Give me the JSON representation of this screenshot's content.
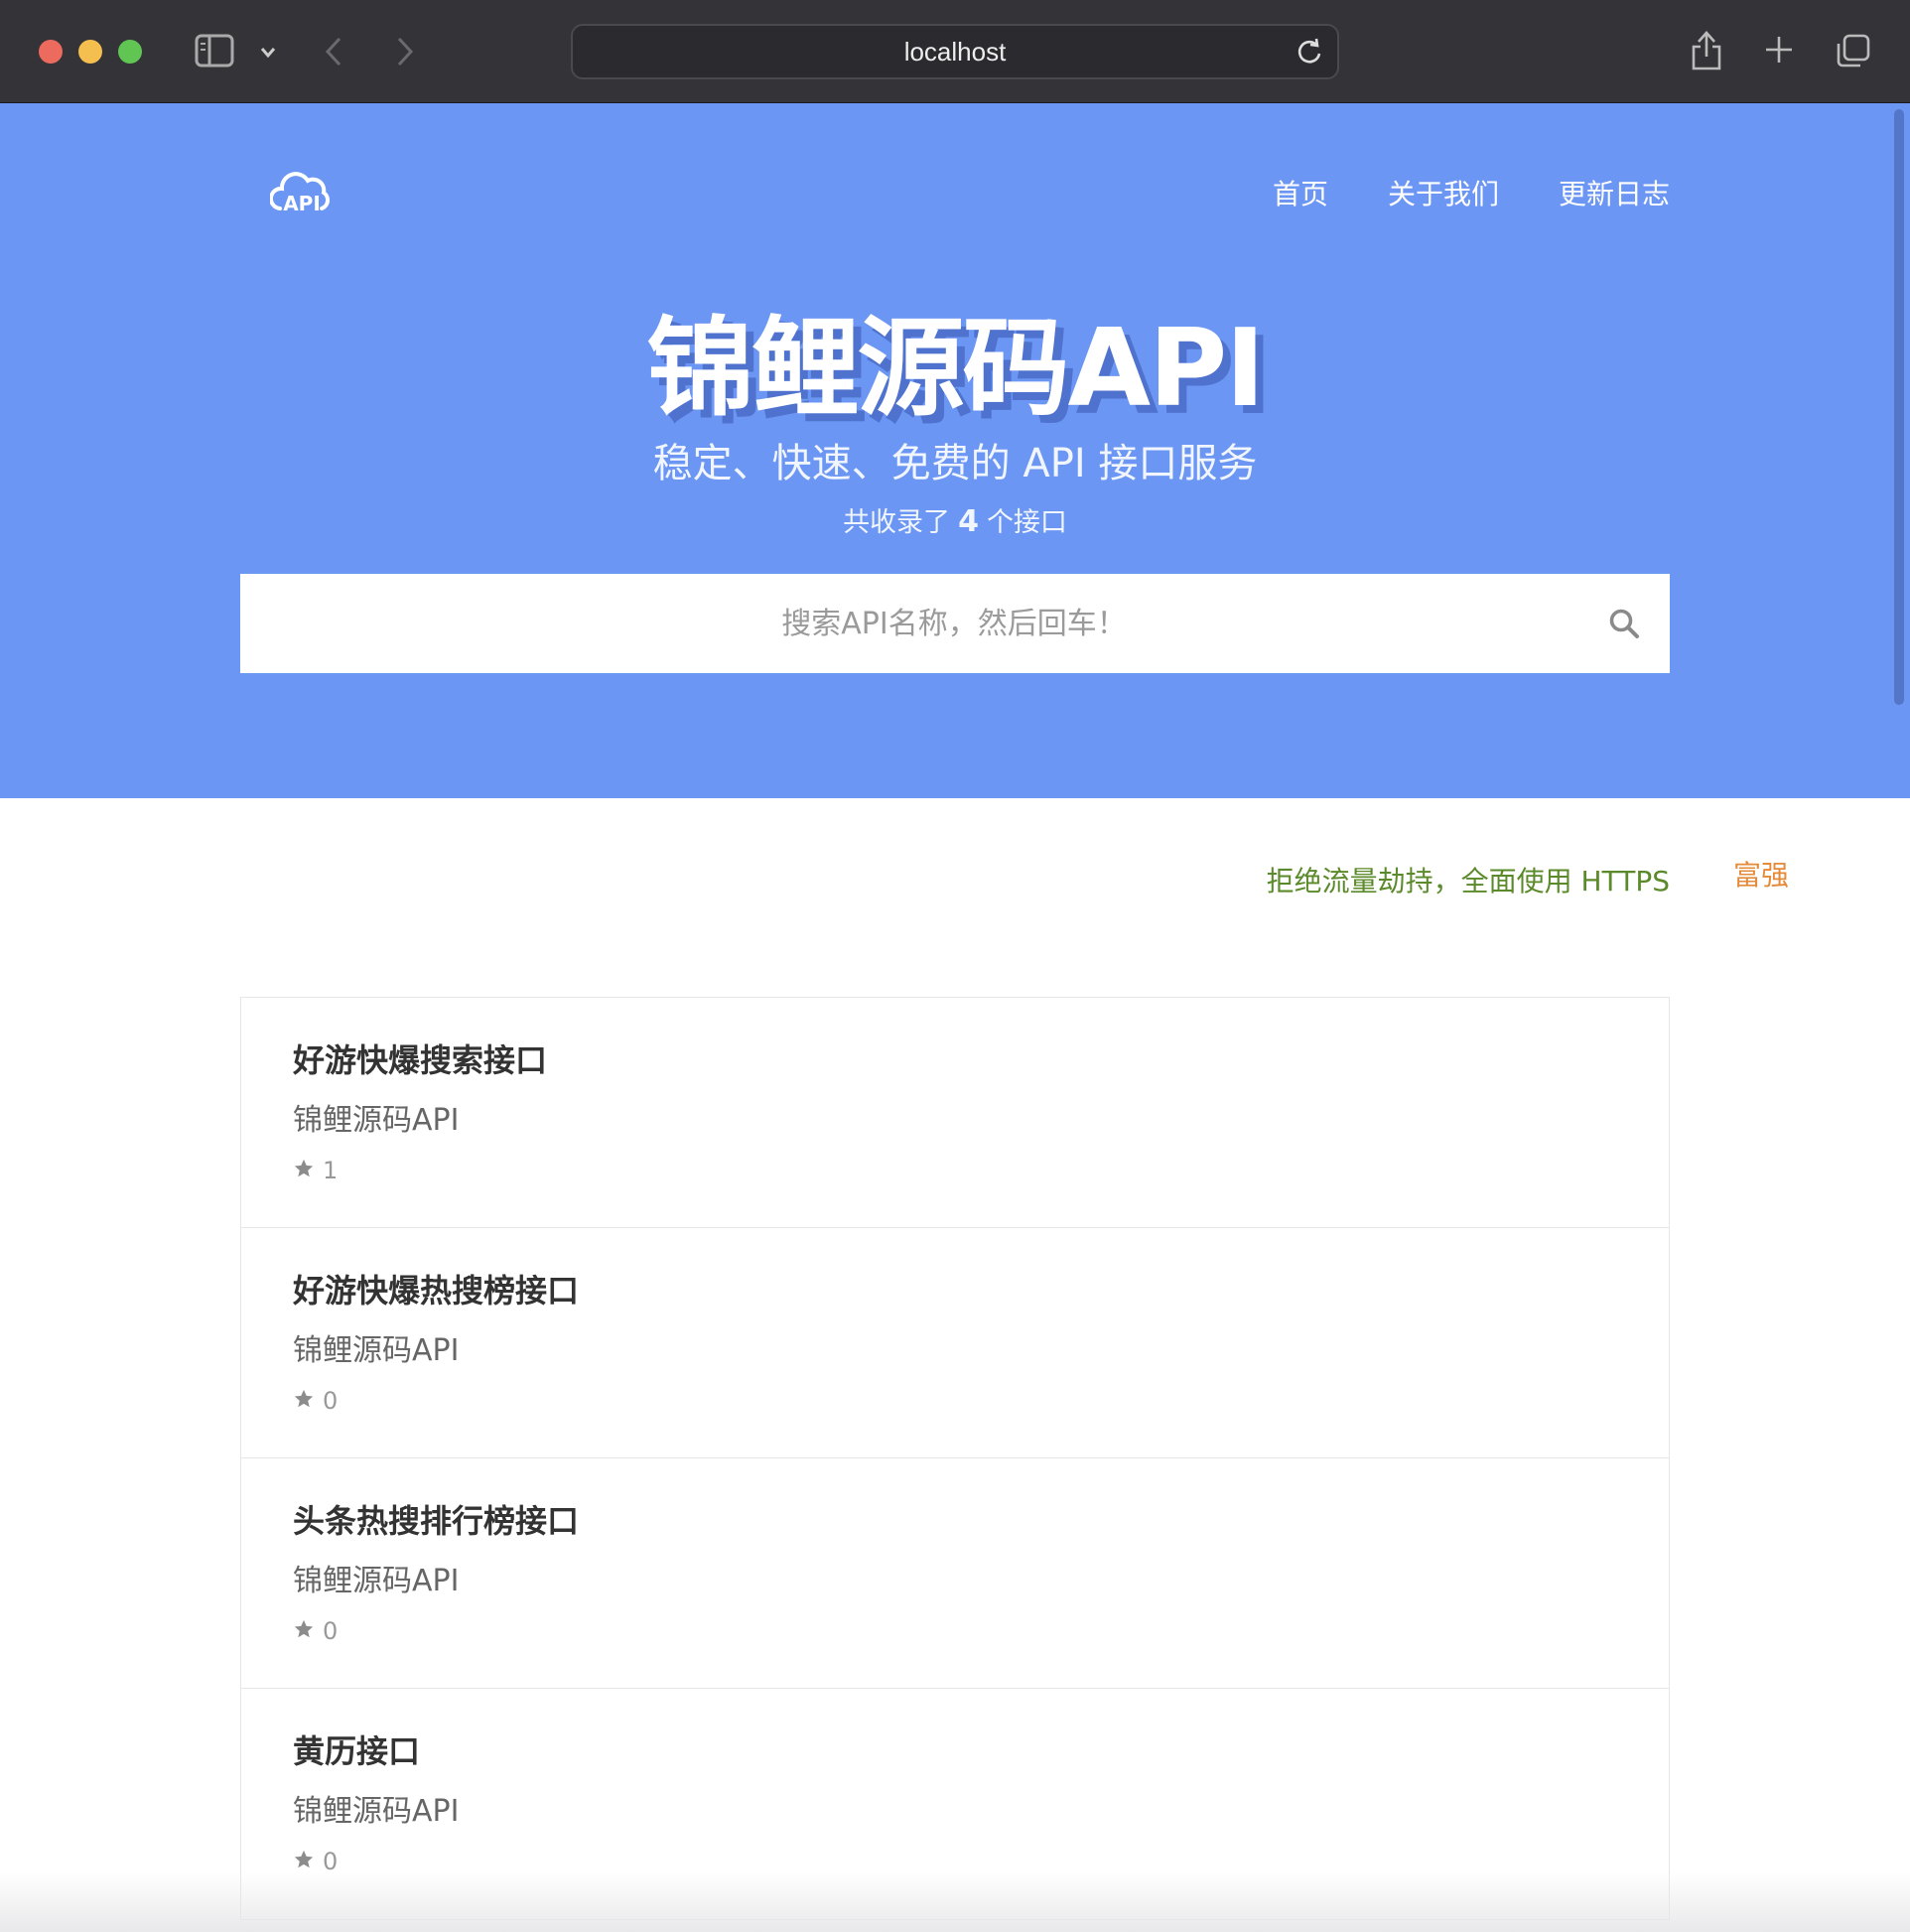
{
  "browser": {
    "url": "localhost"
  },
  "header": {
    "logo_text": "API",
    "nav": [
      {
        "label": "首页"
      },
      {
        "label": "关于我们"
      },
      {
        "label": "更新日志"
      }
    ]
  },
  "hero": {
    "title": "锦鲤源码API",
    "subtitle": "稳定、快速、免费的 API 接口服务",
    "count_prefix": "共收录了",
    "count_value": "4",
    "count_suffix": "个接口"
  },
  "search": {
    "placeholder": "搜索API名称，然后回车！"
  },
  "notices": {
    "https": "拒绝流量劫持，全面使用 HTTPS",
    "side": "富强"
  },
  "apis": [
    {
      "name": "好游快爆搜索接口",
      "author": "锦鲤源码API",
      "stars": "1"
    },
    {
      "name": "好游快爆热搜榜接口",
      "author": "锦鲤源码API",
      "stars": "0"
    },
    {
      "name": "头条热搜排行榜接口",
      "author": "锦鲤源码API",
      "stars": "0"
    },
    {
      "name": "黄历接口",
      "author": "锦鲤源码API",
      "stars": "0"
    }
  ],
  "colors": {
    "hero_bg": "#6b96f3",
    "https_notice": "#5b8a2a",
    "side_notice": "#e38b3b"
  }
}
